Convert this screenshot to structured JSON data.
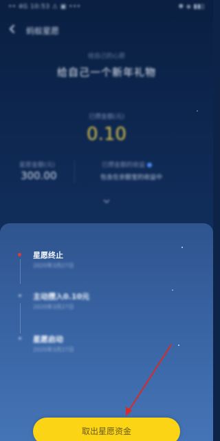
{
  "status_bar": {
    "left_text": "•• 4G 10:53 ⚠ ▣ •••",
    "right_text": "✱ ◈ ▮▮▯"
  },
  "nav": {
    "title": "蚂蚁星愿",
    "back_icon": "chevron-left-icon"
  },
  "wish": {
    "subtitle": "给自己的心愿",
    "title": "给自己一个新年礼物",
    "deposit_label": "已攒金额(元)",
    "deposit_value": "0.10",
    "target_label": "星愿金额(元)",
    "target_value": "300.00",
    "earning_label": "已攒金额的收益",
    "earning_text": "包含在余额宝的收益中"
  },
  "timeline": [
    {
      "title": "星愿终止",
      "date": "2020年3月27日",
      "active": true
    },
    {
      "title": "主动攒入0.10元",
      "date": "2020年3月27日",
      "active": false
    },
    {
      "title": "星愿启动",
      "date": "2020年3月27日",
      "active": false
    }
  ],
  "cta": {
    "label": "取出星愿资金"
  },
  "colors": {
    "background_top": "#0a1f41",
    "panel": "#3a66a6",
    "deposit_value": "#d9c34b",
    "cta_bg": "#fbd416",
    "active_dot": "#e03a3a",
    "annotation_arrow": "#d62b2b"
  }
}
